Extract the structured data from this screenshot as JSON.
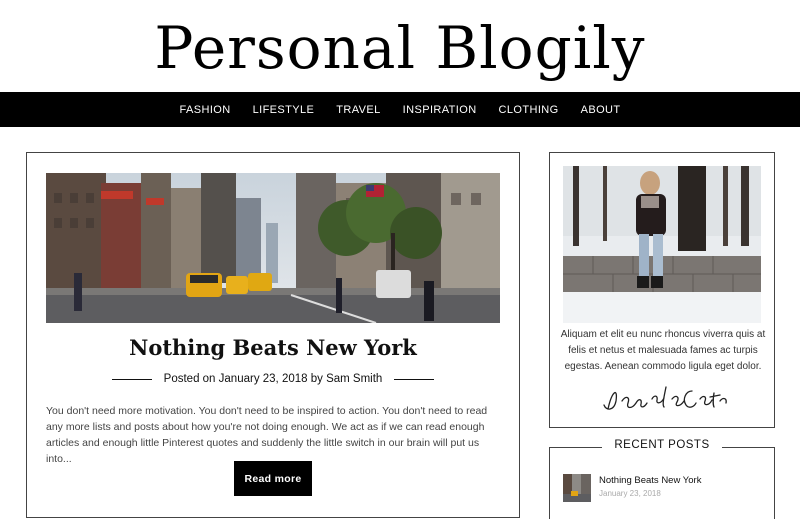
{
  "site": {
    "title": "Personal Blogily"
  },
  "nav": {
    "items": [
      {
        "label": "FASHION"
      },
      {
        "label": "LIFESTYLE"
      },
      {
        "label": "TRAVEL"
      },
      {
        "label": "INSPIRATION"
      },
      {
        "label": "CLOTHING"
      },
      {
        "label": "ABOUT"
      }
    ]
  },
  "post": {
    "title": "Nothing Beats New York",
    "meta_prefix": "Posted on",
    "date": "January 23, 2018",
    "meta_by": "by",
    "author": "Sam Smith",
    "excerpt": "You don't need more motivation. You don't need to be inspired to action. You don't need to read any more lists and posts about how you're not doing enough. We act as if we can read enough articles and enough little Pinterest quotes and suddenly the little switch in our brain will put us into...",
    "read_more_label": "Read more"
  },
  "about": {
    "text": "Aliquam et elit eu nunc rhoncus viverra quis at felis et netus et malesuada fames ac turpis egestas. Aenean commodo ligula eget dolor.",
    "signature": "Jenifer Carter"
  },
  "recent": {
    "heading": "RECENT POSTS",
    "items": [
      {
        "title": "Nothing Beats New York",
        "date": "January 23, 2018"
      }
    ]
  },
  "colors": {
    "nav_bg": "#000000",
    "button_bg": "#000000",
    "text": "#111111",
    "muted": "#aaaaaa"
  }
}
